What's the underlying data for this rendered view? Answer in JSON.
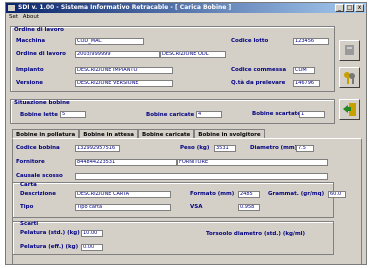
{
  "window": {
    "title": "SDI v. 1.00 - Sistema Informativo Retracable - [ Carica Bobine ]",
    "controls": [
      "_",
      "□",
      "x"
    ]
  },
  "menu": {
    "items": [
      "Set",
      "About"
    ]
  },
  "ordine": {
    "group_label": "Ordine di lavoro",
    "macchina_label": "Macchina",
    "macchina_value": "COD_MAC",
    "codice_lotto_label": "Codice lotto",
    "codice_lotto_value": "123456",
    "ordine_label": "Ordine di lavoro",
    "ordine_value": "2003/999999",
    "descrizione_odl": "DESCRIZIONE ODL",
    "impianto_label": "Impianto",
    "impianto_value": "DESCRIZIONE IMPIANTO",
    "commessa_label": "Codice commessa",
    "commessa_value": "COM",
    "versione_label": "Versione",
    "versione_value": "DESCRIZIONE VERSIONE",
    "qta_label": "Q.tà da prelevare",
    "qta_value": "146796"
  },
  "situazione": {
    "group_label": "Situazione bobine",
    "lette_label": "Bobine lette",
    "lette_value": "5",
    "caricate_label": "Bobine caricate",
    "caricate_value": "4",
    "scartate_label": "Bobine scartate",
    "scartate_value": "1"
  },
  "tabs": [
    "Bobine in pollatura",
    "Bobine in attesa",
    "Bobine caricate",
    "Bobine in svolgitore"
  ],
  "bobina": {
    "codice_label": "Codice bobina",
    "codice_value": "132992957516",
    "peso_label": "Peso (kg)",
    "peso_value": "3531",
    "diametro_label": "Diametro (mm)",
    "diametro_value": "7.5",
    "fornitore_label": "Fornitore",
    "fornitore_code": "844844223531",
    "fornitore_value": "FORNITORE",
    "causale_label": "Causale scosso",
    "carta_label": "Carta",
    "descrizione_label": "Descrizione",
    "descrizione_value": "DESCRIZIONE CARTA",
    "formato_label": "Formato (mm)",
    "formato_value": "2485",
    "grammat_label": "Grammat. (gr/mq)",
    "grammat_value": "60.0",
    "tipo_label": "Tipo",
    "tipo_value": "Tipo carta",
    "vsa_label": "VSA",
    "vsa_value": "0.958",
    "scarti_label": "Scarti",
    "pelatura_std_label": "Pelatura (std.) (kg)",
    "pelatura_std_value": "10.00",
    "torsoolo_label": "Torsoolo diametro (std.) (kg/ml)",
    "pelatura_eff_label": "Pelatura (eff.) (kg)",
    "pelatura_eff_value": "0.00"
  },
  "icons": [
    "app-icon",
    "refresh-icon",
    "keys-icon",
    "exit-icon"
  ]
}
